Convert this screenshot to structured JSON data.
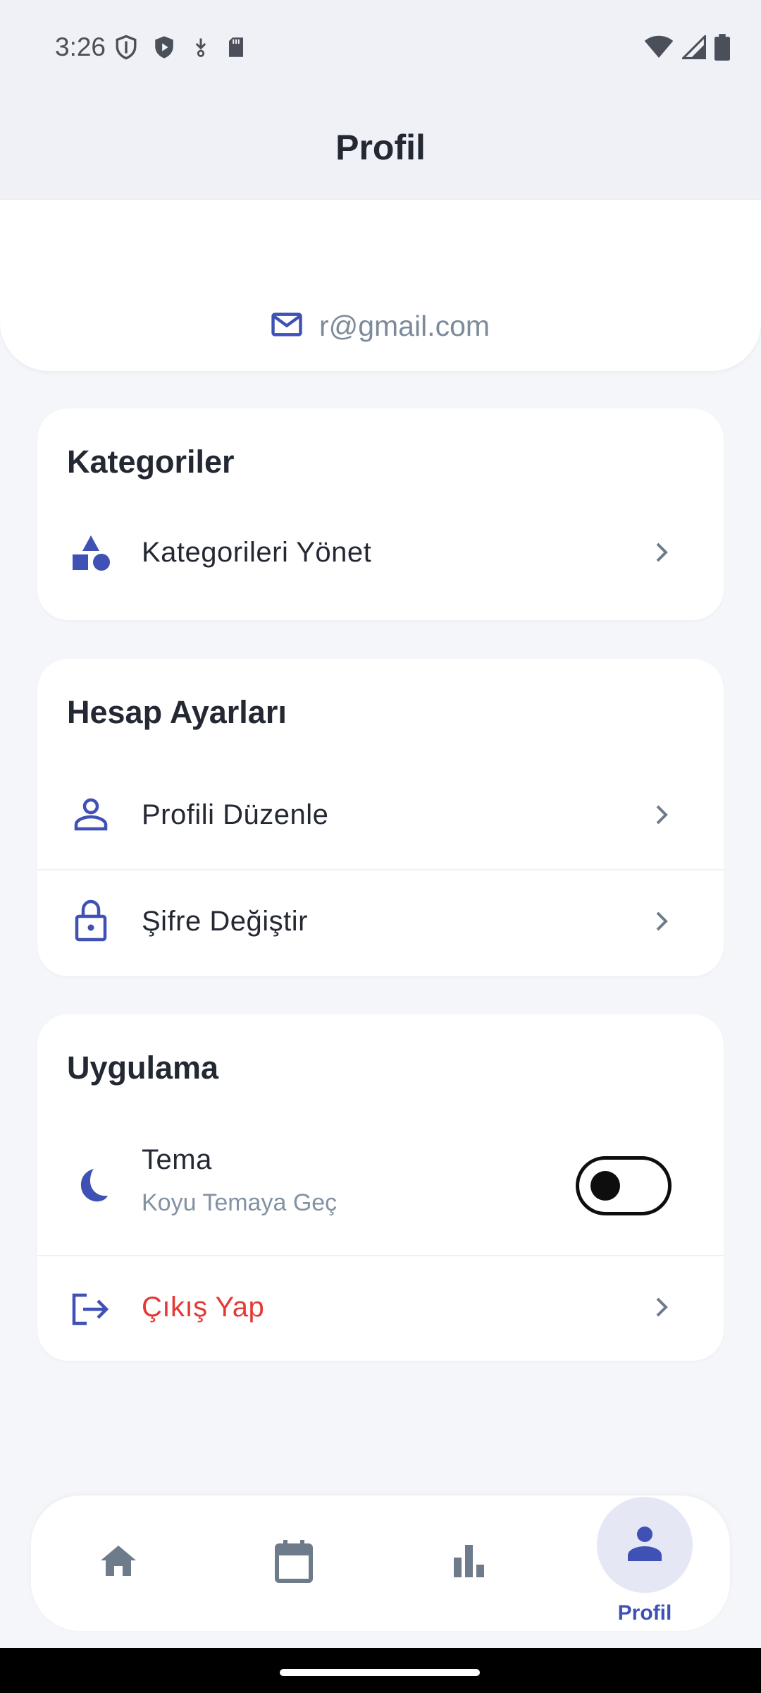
{
  "status_bar": {
    "time": "3:26",
    "left_icons": [
      "shield-outline-icon",
      "shield-play-icon",
      "download-icon",
      "sd-card-icon"
    ],
    "right_icons": [
      "wifi-icon",
      "signal-icon",
      "battery-icon"
    ]
  },
  "app_bar": {
    "title": "Profil"
  },
  "profile": {
    "email": "r@gmail.com"
  },
  "sections": {
    "categories": {
      "title": "Kategoriler",
      "items": [
        {
          "label": "Kategorileri Yönet",
          "icon": "category-icon"
        }
      ]
    },
    "account": {
      "title": "Hesap Ayarları",
      "items": [
        {
          "label": "Profili Düzenle",
          "icon": "person-outline-icon"
        },
        {
          "label": "Şifre Değiştir",
          "icon": "lock-icon"
        }
      ]
    },
    "app": {
      "title": "Uygulama",
      "theme": {
        "label": "Tema",
        "subtitle": "Koyu Temaya Geç",
        "icon": "moon-icon",
        "enabled": false
      },
      "logout": {
        "label": "Çıkış Yap",
        "icon": "logout-icon"
      }
    }
  },
  "bottom_nav": {
    "items": [
      {
        "id": "home",
        "icon": "home-icon",
        "label": ""
      },
      {
        "id": "calendar",
        "icon": "calendar-icon",
        "label": ""
      },
      {
        "id": "stats",
        "icon": "bar-chart-icon",
        "label": ""
      },
      {
        "id": "profile",
        "icon": "person-icon",
        "label": "Profil",
        "active": true
      }
    ]
  },
  "colors": {
    "accent": "#3F51B5",
    "danger": "#E53935",
    "muted_text": "#7C8A9A",
    "background": "#F5F6FA"
  }
}
